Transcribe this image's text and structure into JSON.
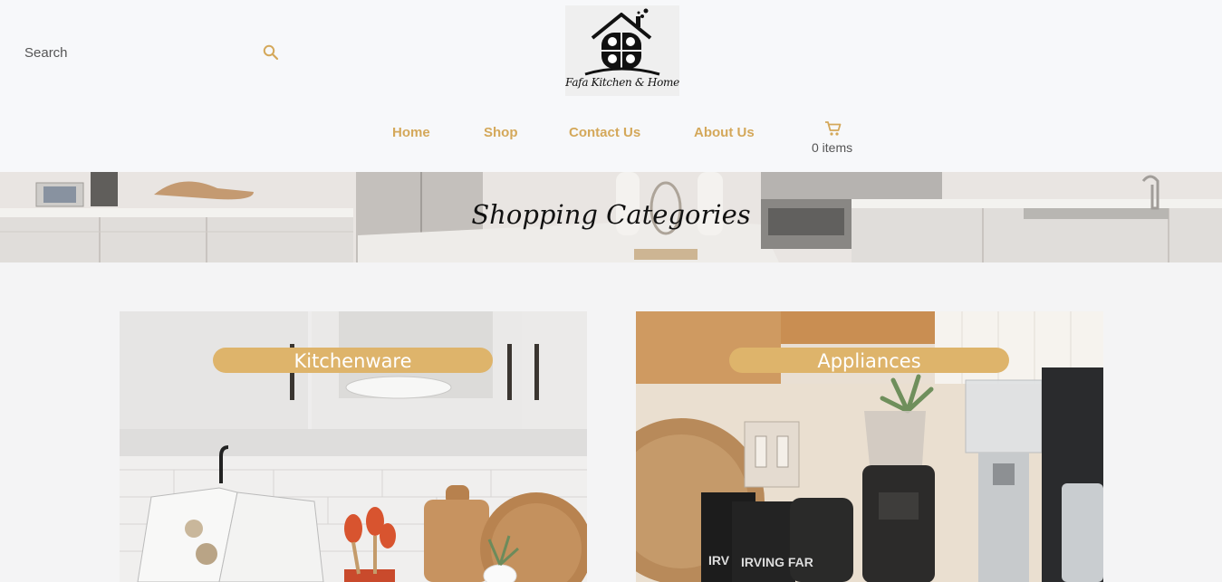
{
  "header": {
    "search_placeholder": "Search",
    "logo_text": "Fafa Kitchen & Home",
    "nav": [
      {
        "label": "Home"
      },
      {
        "label": "Shop"
      },
      {
        "label": "Contact Us"
      },
      {
        "label": "About Us"
      }
    ],
    "cart_count": "0 items"
  },
  "banner": {
    "title": "Shopping Categories"
  },
  "categories": [
    {
      "label": "Kitchenware"
    },
    {
      "label": "Appliances"
    }
  ],
  "colors": {
    "accent": "#deb46b",
    "nav_text": "#d4a85a",
    "header_bg": "#f7f8fa",
    "page_bg": "#f4f4f5"
  },
  "icons": [
    "search-icon",
    "cart-icon"
  ]
}
